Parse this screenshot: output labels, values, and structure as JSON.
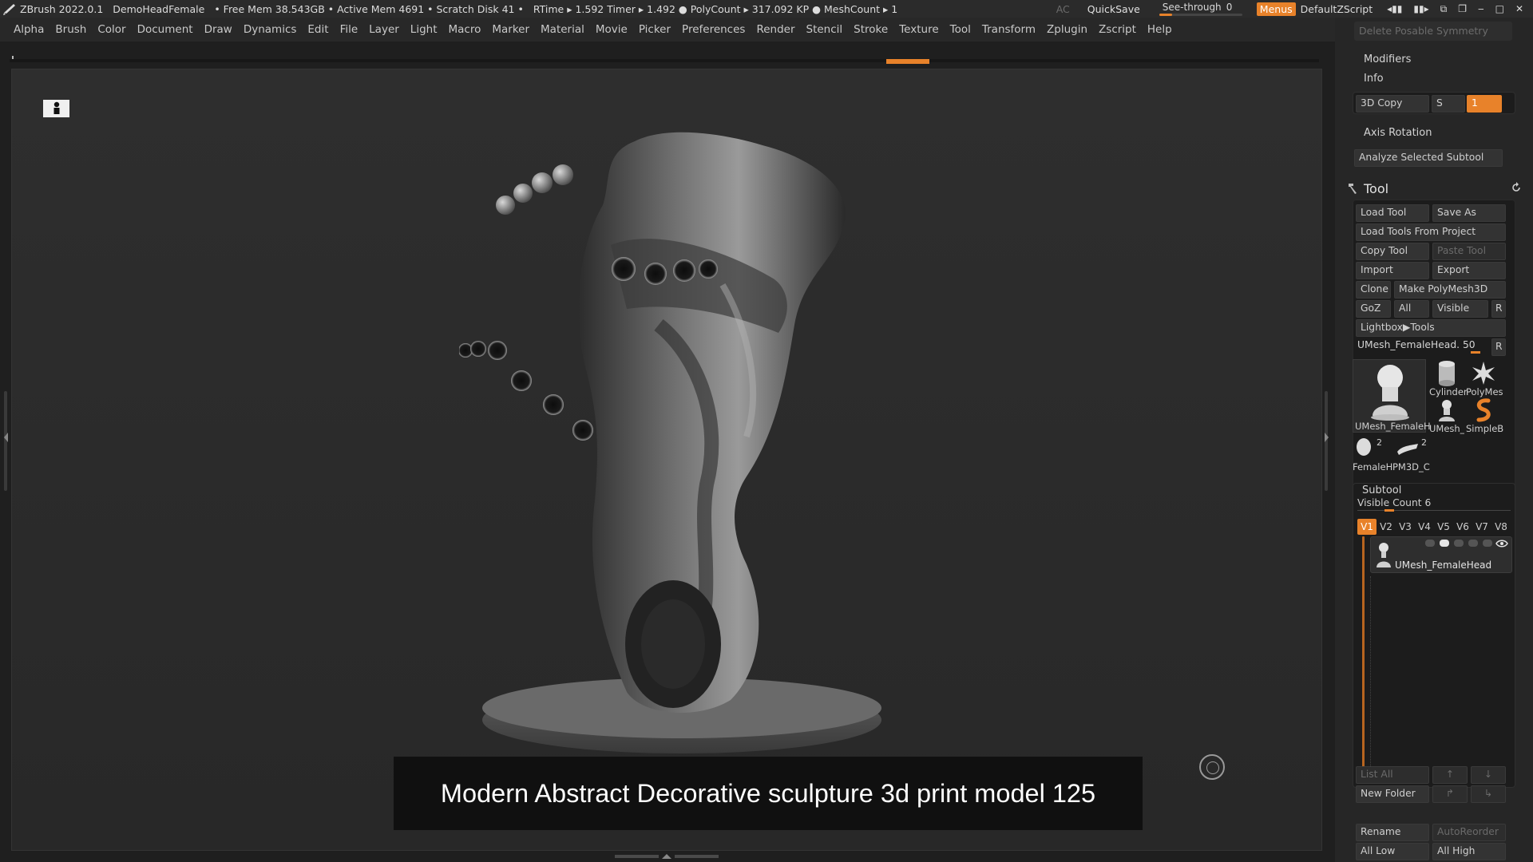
{
  "titlebar": {
    "app": "ZBrush 2022.0.1",
    "document": "DemoHeadFemale",
    "stats": "• Free Mem 38.543GB • Active Mem 4691 • Scratch Disk 41 •",
    "timing": "RTime ▸ 1.592 Timer ▸ 1.492 ● PolyCount ▸ 317.092 KP ● MeshCount ▸ 1",
    "ac": "AC",
    "quicksave": "QuickSave",
    "seethrough_label": "See-through",
    "seethrough_value": "0",
    "menus": "Menus",
    "script": "DefaultZScript"
  },
  "menubar": {
    "items": [
      "Alpha",
      "Brush",
      "Color",
      "Document",
      "Draw",
      "Dynamics",
      "Edit",
      "File",
      "Layer",
      "Light",
      "Macro",
      "Marker",
      "Material",
      "Movie",
      "Picker",
      "Preferences",
      "Render",
      "Stencil",
      "Stroke",
      "Texture",
      "Tool",
      "Transform",
      "Zplugin",
      "Zscript",
      "Help"
    ]
  },
  "canvas": {
    "caption": "Modern Abstract Decorative sculpture 3d print model 125"
  },
  "rpanel": {
    "delete_posable": "Delete Posable Symmetry",
    "modifiers": "Modifiers",
    "info": "Info",
    "copy3d": "3D Copy",
    "copy3d_s": "S",
    "copy3d_val": "1",
    "axis_rotation": "Axis Rotation",
    "analyze": "Analyze Selected Subtool",
    "tool_title": "Tool",
    "load_tool": "Load Tool",
    "save_as": "Save As",
    "load_from_project": "Load Tools From Project",
    "copy_tool": "Copy Tool",
    "paste_tool": "Paste Tool",
    "import": "Import",
    "export": "Export",
    "clone": "Clone",
    "make_polymesh": "Make PolyMesh3D",
    "goz": "GoZ",
    "all": "All",
    "visible": "Visible",
    "r": "R",
    "lightbox_tools": "Lightbox▶Tools",
    "umesh_slider": "UMesh_FemaleHead. 50",
    "thumbs": {
      "big": "UMesh_FemaleH",
      "cylinder": "Cylinder",
      "polymesh": "PolyMes",
      "umesh_small": "UMesh_",
      "simpleb": "SimpleB",
      "female": "FemaleH",
      "female_count": "2",
      "pm3d": "PM3D_C",
      "pm3d_count": "2"
    },
    "subtool": "Subtool",
    "visible_count": "Visible Count 6",
    "vtabs": [
      "V1",
      "V2",
      "V3",
      "V4",
      "V5",
      "V6",
      "V7",
      "V8"
    ],
    "subtool_name": "UMesh_FemaleHead",
    "list_all": "List All",
    "new_folder": "New Folder",
    "rename": "Rename",
    "auto_reorder": "AutoReorder",
    "all_low": "All Low",
    "all_high": "All High"
  },
  "colors": {
    "accent": "#e8822a",
    "panel": "#262626",
    "canvas": "#2b2b2b"
  }
}
